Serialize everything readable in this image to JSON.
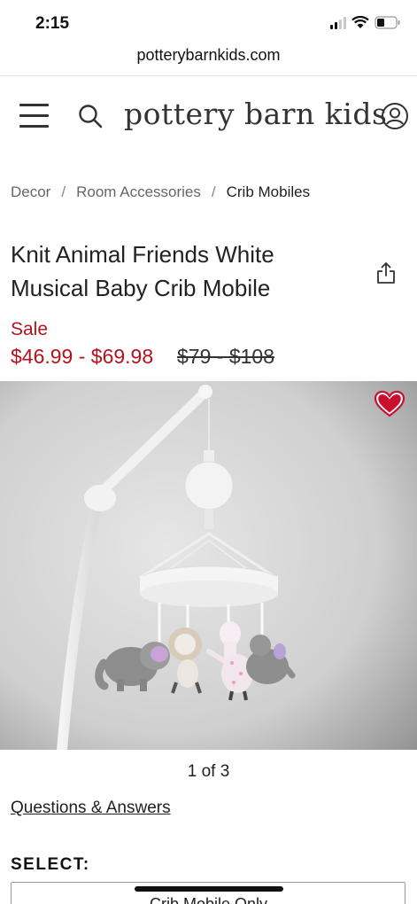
{
  "status_bar": {
    "time": "2:15"
  },
  "browser": {
    "url": "potterybarnkids.com"
  },
  "header": {
    "logo": "pottery barn kids"
  },
  "breadcrumb": {
    "items": [
      "Decor",
      "Room Accessories",
      "Crib Mobiles"
    ],
    "separator": "/"
  },
  "product": {
    "title": "Knit Animal Friends White Musical Baby Crib Mobile",
    "sale_label": "Sale",
    "sale_price": "$46.99 - $69.98",
    "original_price": "$79 - $108"
  },
  "gallery": {
    "counter": "1 of 3"
  },
  "links": {
    "qa": "Questions & Answers"
  },
  "select": {
    "label": "SELECT:",
    "value": "Crib Mobile Only"
  },
  "colors": {
    "sale_red": "#b5121b",
    "heart_red": "#c8102e",
    "background": "#ffffff"
  }
}
